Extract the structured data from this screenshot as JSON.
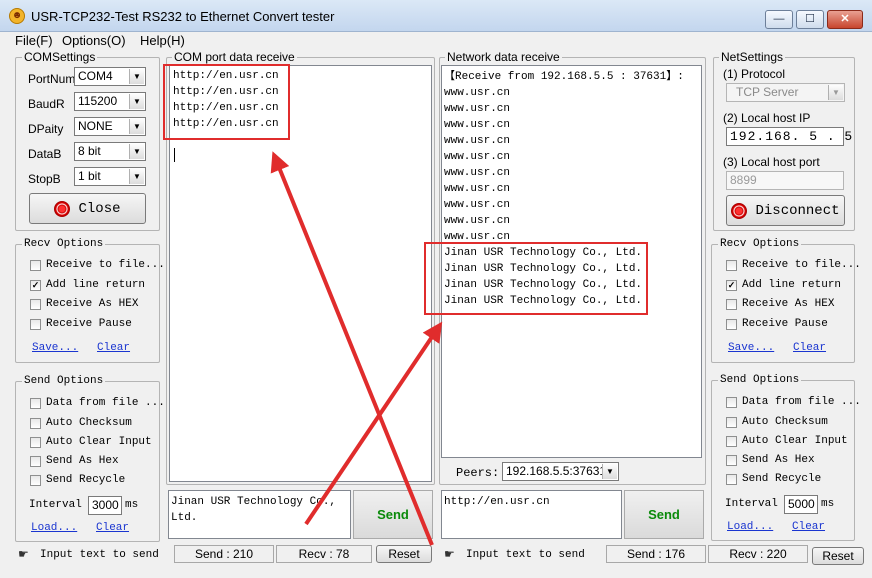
{
  "window": {
    "title": "USR-TCP232-Test  RS232 to Ethernet Convert tester",
    "app_icon": "usr-app-icon",
    "controls": {
      "minimize": "—",
      "maximize": "☐",
      "close": "✕"
    }
  },
  "menu": [
    "File(F)",
    "Options(O)",
    "Help(H)"
  ],
  "com_settings": {
    "title": "COMSettings",
    "rows": [
      {
        "label": "PortNum",
        "value": "COM4"
      },
      {
        "label": "BaudR",
        "value": "115200"
      },
      {
        "label": "DPaity",
        "value": "NONE"
      },
      {
        "label": "DataB",
        "value": "8 bit"
      },
      {
        "label": "StopB",
        "value": "1 bit"
      }
    ],
    "button": "Close"
  },
  "left_recv": {
    "title": "Recv Options",
    "options": [
      {
        "label": "Receive to file...",
        "checked": false
      },
      {
        "label": "Add line return",
        "checked": true
      },
      {
        "label": "Receive As HEX",
        "checked": false
      },
      {
        "label": "Receive Pause",
        "checked": false
      }
    ],
    "save": "Save...",
    "clear": "Clear"
  },
  "left_send": {
    "title": "Send Options",
    "options": [
      {
        "label": "Data from file ...",
        "checked": false
      },
      {
        "label": "Auto Checksum",
        "checked": false
      },
      {
        "label": "Auto Clear Input",
        "checked": false
      },
      {
        "label": "Send As Hex",
        "checked": false
      },
      {
        "label": "Send Recycle",
        "checked": false
      }
    ],
    "interval_label": "Interval",
    "interval_value": "3000",
    "unit": "ms",
    "load": "Load...",
    "clear": "Clear"
  },
  "com_receive": {
    "title": "COM port data receive",
    "lines": [
      "http://en.usr.cn",
      "http://en.usr.cn",
      "http://en.usr.cn",
      "http://en.usr.cn"
    ]
  },
  "com_send": {
    "text_lines": [
      "Jinan USR Technology Co.,",
      "Ltd."
    ],
    "send_button": "Send"
  },
  "net_receive": {
    "title": "Network data receive",
    "header": "【Receive from 192.168.5.5 : 37631】:",
    "lines": [
      "www.usr.cn",
      "www.usr.cn",
      "www.usr.cn",
      "www.usr.cn",
      "www.usr.cn",
      "www.usr.cn",
      "www.usr.cn",
      "www.usr.cn",
      "www.usr.cn",
      "www.usr.cn",
      "Jinan USR Technology Co., Ltd.",
      "Jinan USR Technology Co., Ltd.",
      "Jinan USR Technology Co., Ltd.",
      "Jinan USR Technology Co., Ltd."
    ],
    "peers_label": "Peers:",
    "peers_value": "192.168.5.5:37631"
  },
  "net_send": {
    "text": "http://en.usr.cn",
    "send_button": "Send"
  },
  "net_settings": {
    "title": "NetSettings",
    "protocol_label": "(1) Protocol",
    "protocol_value": "TCP Server",
    "ip_label": "(2) Local host IP",
    "ip_value": "192.168. 5 . 5",
    "port_label": "(3) Local host port",
    "port_value": "8899",
    "button": "Disconnect"
  },
  "right_recv": {
    "title": "Recv Options",
    "options": [
      {
        "label": "Receive to file...",
        "checked": false
      },
      {
        "label": "Add line return",
        "checked": true
      },
      {
        "label": "Receive As HEX",
        "checked": false
      },
      {
        "label": "Receive Pause",
        "checked": false
      }
    ],
    "save": "Save...",
    "clear": "Clear"
  },
  "right_send": {
    "title": "Send Options",
    "options": [
      {
        "label": "Data from file ...",
        "checked": false
      },
      {
        "label": "Auto Checksum",
        "checked": false
      },
      {
        "label": "Auto Clear Input",
        "checked": false
      },
      {
        "label": "Send As Hex",
        "checked": false
      },
      {
        "label": "Send Recycle",
        "checked": false
      }
    ],
    "interval_label": "Interval",
    "interval_value": "5000",
    "unit": "ms",
    "load": "Load...",
    "clear": "Clear"
  },
  "status_left": {
    "hint": "Input text to send",
    "send": "Send : 210",
    "recv": "Recv : 78",
    "reset": "Reset"
  },
  "status_right": {
    "hint": "Input text to send",
    "send": "Send : 176",
    "recv": "Recv : 220",
    "reset": "Reset"
  },
  "colors": {
    "annotation": "#e02c2c",
    "send_text": "#0a8a0a",
    "link": "#1a35d0"
  }
}
